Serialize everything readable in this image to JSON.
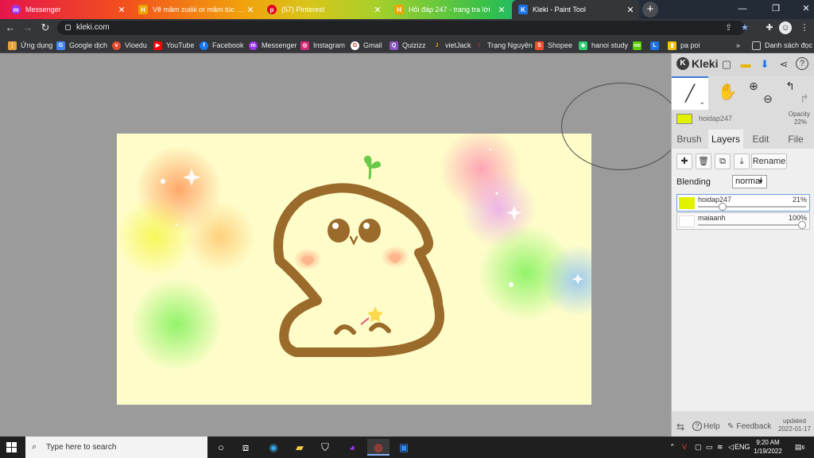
{
  "browser": {
    "tabs": [
      {
        "label": "Messenger",
        "icon": "messenger-icon",
        "color": "#a233f0",
        "active": false
      },
      {
        "label": "Vẽ mầm zuiiiii or mầm túc mừn…",
        "icon": "hoidap-icon",
        "color": "#e9a500",
        "active": false
      },
      {
        "label": "(57) Pinterest",
        "icon": "pinterest-icon",
        "color": "#e60023",
        "active": false
      },
      {
        "label": "Hỏi đáp 247 - trang tra lời",
        "icon": "hoidap-icon",
        "color": "#e9a500",
        "active": false
      },
      {
        "label": "Kleki - Paint Tool",
        "icon": "kleki-icon",
        "color": "#1a73e8",
        "active": true
      }
    ],
    "url": "kleki.com",
    "bookmarks": [
      {
        "label": "Ứng dụng",
        "icon": "apps-icon",
        "color": "#e8a33d"
      },
      {
        "label": "Google dịch",
        "icon": "translate-icon",
        "color": "#4285f4"
      },
      {
        "label": "Vioedu",
        "icon": "vioedu-icon",
        "color": "#e54b2a"
      },
      {
        "label": "YouTube",
        "icon": "youtube-icon",
        "color": "#ff0000"
      },
      {
        "label": "Facebook",
        "icon": "facebook-icon",
        "color": "#1877f2"
      },
      {
        "label": "Messenger",
        "icon": "messenger-icon",
        "color": "#a233f0"
      },
      {
        "label": "Instagram",
        "icon": "instagram-icon",
        "color": "#d62976"
      },
      {
        "label": "Gmail",
        "icon": "gmail-icon",
        "color": "#ffffff"
      },
      {
        "label": "Quizizz",
        "icon": "quizizz-icon",
        "color": "#8854c0"
      },
      {
        "label": "vietJack",
        "icon": "vietjack-icon",
        "color": "#f39c12"
      },
      {
        "label": "Trạng Nguyên",
        "icon": "trangnguyen-icon",
        "color": "#c0392b"
      },
      {
        "label": "Shopee",
        "icon": "shopee-icon",
        "color": "#ee4d2d"
      },
      {
        "label": "hanoi study",
        "icon": "hanoistudy-icon",
        "color": "#2ecc71"
      },
      {
        "label": "pa poi",
        "icon": "papoi-icon",
        "color": "#f1c40f"
      }
    ],
    "reading_list": "Danh sách đọc",
    "more_bookmarks": "»"
  },
  "kleki": {
    "logo": "Kleki",
    "color_name": "hoidap247",
    "primary_color": "#e1f200",
    "opacity_label": "Opacity",
    "opacity_value": "22%",
    "tabs": [
      "Brush",
      "Layers",
      "Edit",
      "File"
    ],
    "selected_tab": "Layers",
    "rename_label": "Rename",
    "blending_label": "Blending",
    "blending_value": "normal",
    "layers": [
      {
        "name": "hoidap247",
        "opacity": "21%",
        "opacity_fraction": 0.21,
        "selected": true
      },
      {
        "name": "maiaanh",
        "opacity": "100%",
        "opacity_fraction": 1.0,
        "selected": false
      }
    ],
    "help_label": "Help",
    "feedback_label": "Feedback",
    "updated_label": "updated",
    "updated_date": "2022-01-17"
  },
  "taskbar": {
    "search_placeholder": "Type here to search",
    "language": "ENG",
    "time": "9:20 AM",
    "date": "1/19/2022",
    "notification_count": "6"
  }
}
